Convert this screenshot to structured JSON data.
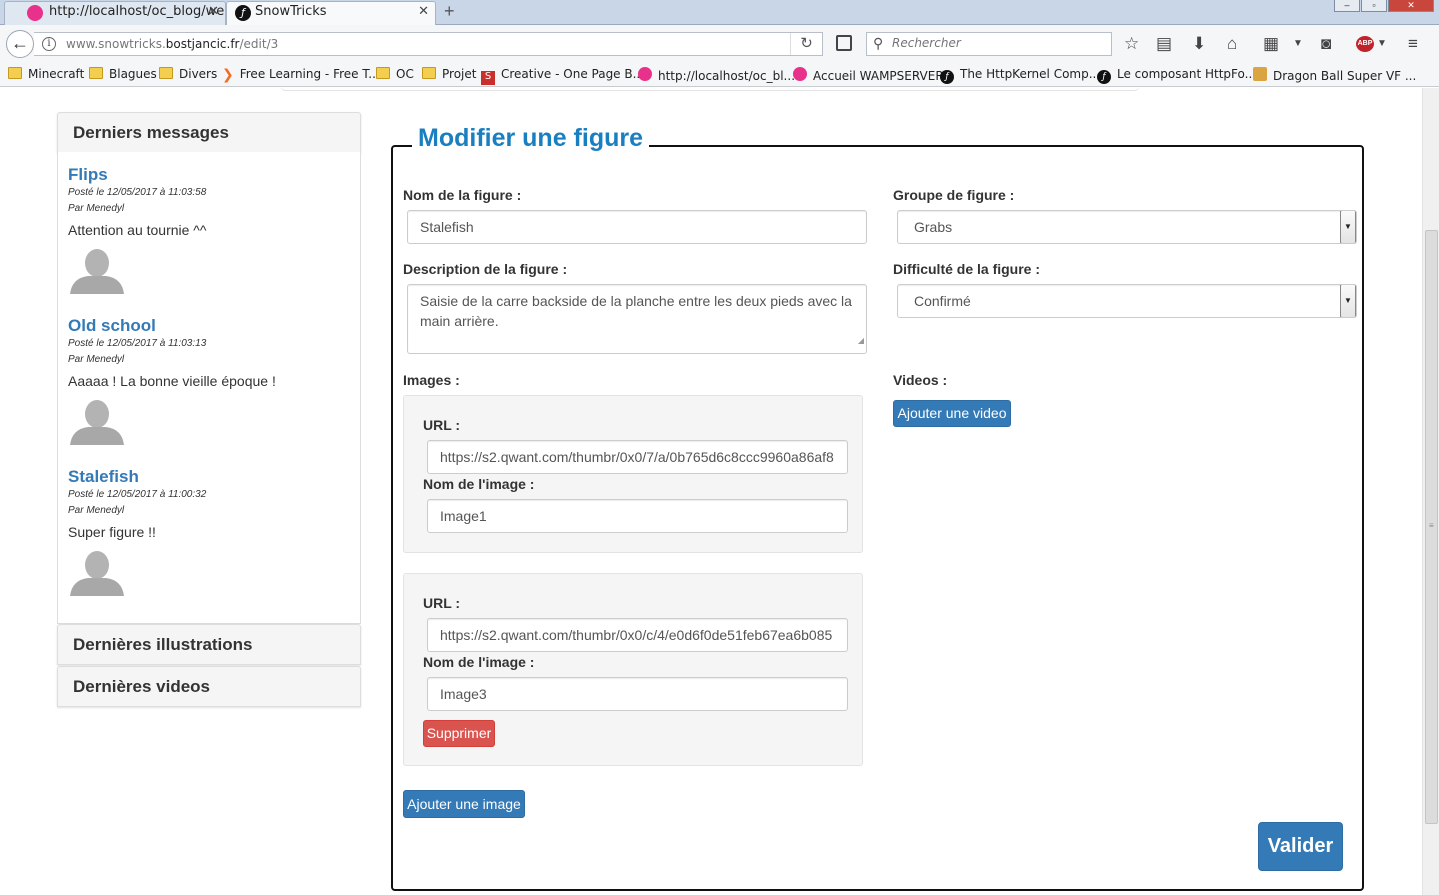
{
  "browser": {
    "tabs": [
      {
        "title": "http://localhost/oc_blog/web",
        "icon": "wampserver-icon",
        "active": false
      },
      {
        "title": "SnowTricks",
        "icon": "symfony-icon",
        "active": true
      }
    ],
    "url": {
      "prefix": "www.snowtricks.",
      "domain": "bostjancic.fr",
      "path": "/edit/3"
    },
    "search_placeholder": "Rechercher",
    "bookmarks": [
      {
        "label": "Minecraft",
        "icon": "folder-icon"
      },
      {
        "label": "Blagues",
        "icon": "folder-icon"
      },
      {
        "label": "Divers",
        "icon": "folder-icon"
      },
      {
        "label": "Free Learning - Free T...",
        "icon": "packt-icon"
      },
      {
        "label": "OC",
        "icon": "folder-icon"
      },
      {
        "label": "Projet",
        "icon": "folder-icon"
      },
      {
        "label": "Creative - One Page B...",
        "icon": "startbootstrap-icon"
      },
      {
        "label": "http://localhost/oc_bl...",
        "icon": "wampserver-icon"
      },
      {
        "label": "Accueil WAMPSERVER",
        "icon": "wampserver-icon"
      },
      {
        "label": "The HttpKernel Comp...",
        "icon": "symfony-icon"
      },
      {
        "label": "Le composant HttpFo...",
        "icon": "symfony-icon"
      },
      {
        "label": "Dragon Ball Super VF ...",
        "icon": "dragonball-icon"
      }
    ]
  },
  "sidebar": {
    "latest_messages_title": "Derniers messages",
    "messages": [
      {
        "title": "Flips",
        "posted": "Posté le 12/05/2017 à 11:03:58",
        "author": "Par Menedyl",
        "text": "Attention au tournie ^^"
      },
      {
        "title": "Old school",
        "posted": "Posté le 12/05/2017 à 11:03:13",
        "author": "Par Menedyl",
        "text": "Aaaaa ! La bonne vieille époque !"
      },
      {
        "title": "Stalefish",
        "posted": "Posté le 12/05/2017 à 11:00:32",
        "author": "Par Menedyl",
        "text": "Super figure !!"
      }
    ],
    "latest_illustrations_title": "Dernières illustrations",
    "latest_videos_title": "Dernières videos"
  },
  "form": {
    "legend": "Modifier une figure",
    "name_label": "Nom de la figure :",
    "name_value": "Stalefish",
    "group_label": "Groupe de figure :",
    "group_value": "Grabs",
    "description_label": "Description de la figure :",
    "description_value": "Saisie de la carre backside de la planche entre les deux pieds avec la main arrière.",
    "difficulty_label": "Difficulté de la figure :",
    "difficulty_value": "Confirmé",
    "images_label": "Images :",
    "videos_label": "Videos :",
    "add_video_label": "Ajouter une video",
    "images": [
      {
        "url_label": "URL :",
        "url_value": "https://s2.qwant.com/thumbr/0x0/7/a/0b765d6c8ccc9960a86af8",
        "name_label": "Nom de l'image :",
        "name_value": "Image1"
      },
      {
        "url_label": "URL :",
        "url_value": "https://s2.qwant.com/thumbr/0x0/c/4/e0d6f0de51feb67ea6b085",
        "name_label": "Nom de l'image :",
        "name_value": "Image3",
        "delete_label": "Supprimer"
      }
    ],
    "add_image_label": "Ajouter une image",
    "submit_label": "Valider"
  },
  "colors": {
    "primary": "#337ab7",
    "danger": "#d9534f",
    "legend": "#1a7fc1",
    "link": "#337ab7"
  }
}
